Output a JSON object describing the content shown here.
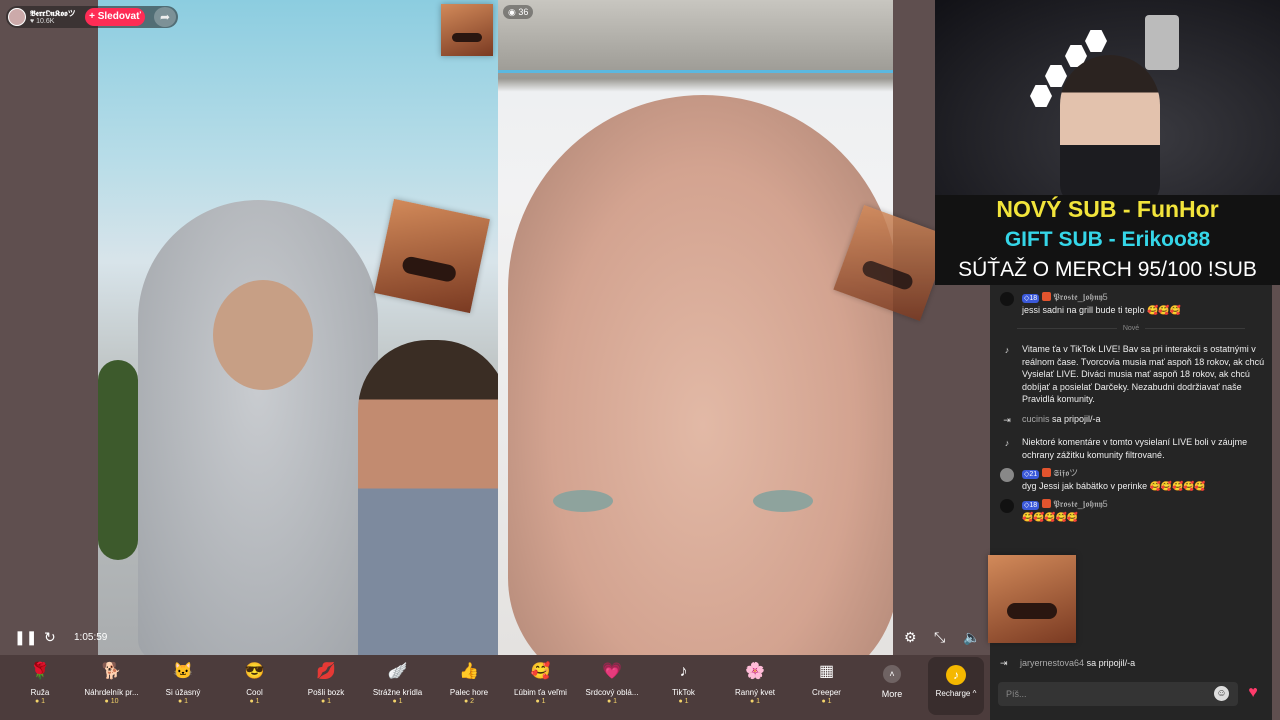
{
  "header": {
    "streamer_name": "𝕭𝖊𝖗𝖗𝕺𝖓𝕶𝖔𝖔ツ",
    "follower_count": "10.6K",
    "follow_label": "+ Sledovať",
    "share_icon": "share-arrow-icon",
    "viewer_count": "36"
  },
  "player": {
    "time": "1:05:59",
    "pause_icon": "pause-icon",
    "refresh_icon": "refresh-icon",
    "settings_icon": "settings-icon",
    "fullscreen_exit_icon": "fullscreen-exit-icon",
    "volume_icon": "volume-icon"
  },
  "gifts": [
    {
      "name": "Ruža",
      "price": "1",
      "icon": "🌹"
    },
    {
      "name": "Náhrdelník pr...",
      "price": "10",
      "icon": "🐕"
    },
    {
      "name": "Si úžasný",
      "price": "1",
      "icon": "🐱"
    },
    {
      "name": "Cool",
      "price": "1",
      "icon": "😎"
    },
    {
      "name": "Pošli bozk",
      "price": "1",
      "icon": "💋"
    },
    {
      "name": "Strážne krídla",
      "price": "1",
      "icon": "🪽"
    },
    {
      "name": "Palec hore",
      "price": "2",
      "icon": "👍"
    },
    {
      "name": "Ľúbim ťa veľmi",
      "price": "1",
      "icon": "🥰"
    },
    {
      "name": "Srdcový oblá...",
      "price": "1",
      "icon": "💗"
    },
    {
      "name": "TikTok",
      "price": "1",
      "icon": "♪"
    },
    {
      "name": "Ranný kvet",
      "price": "1",
      "icon": "🌸"
    },
    {
      "name": "Creeper",
      "price": "1",
      "icon": "▦"
    }
  ],
  "more_label": "More",
  "recharge_label": "Recharge ^",
  "overlay": {
    "line1": "NOVÝ SUB - FunHor",
    "line2": "GIFT SUB - Erikoo88",
    "line3": "SÚŤAŽ O MERCH  95/100 !SUB",
    "color1": "#f2e43b",
    "color2": "#35d6e8"
  },
  "chat": {
    "messages": [
      {
        "level": "18",
        "user": "𝕻𝖗𝖔𝖘𝖙𝖊_𝖏𝖔𝖍𝖓𝖞5",
        "text": "jessi sadni na grill bude ti teplo 🥰🥰🥰"
      },
      {
        "system": "Vitame ťa v TikTok LIVE! Bav sa pri interakcii s ostatnými v reálnom čase. Tvorcovia musia mať aspoň 18 rokov, ak chcú Vysielať LIVE. Diváci musia mať aspoň 18 rokov, ak chcú dobíjať a posielať Darčeky. Nezabudni dodržiavať naše Pravidlá komunity."
      },
      {
        "join_user": "cucinis",
        "join_text": "sa pripojil/-a"
      },
      {
        "system2": "Niektoré komentáre v tomto vysielaní LIVE boli v záujme ochrany zážitku komunity filtrované."
      },
      {
        "level": "21",
        "user": "𝕾𝖎𝖋𝖔ツ",
        "text": "dyg Jessi jak bábätko v perinke 🥰🥰🥰🥰🥰"
      },
      {
        "level": "18",
        "user": "𝕻𝖗𝖔𝖘𝖙𝖊_𝖏𝖔𝖍𝖓𝖞5",
        "text": "🥰🥰🥰🥰🥰"
      }
    ],
    "new_divider": "Nové",
    "bottom_join_user": "jaryernestova64",
    "bottom_join_text": "sa pripojil/-a",
    "input_placeholder": "Píš...",
    "emoji_icon": "emoji-icon",
    "heart_icon": "heart-icon"
  }
}
